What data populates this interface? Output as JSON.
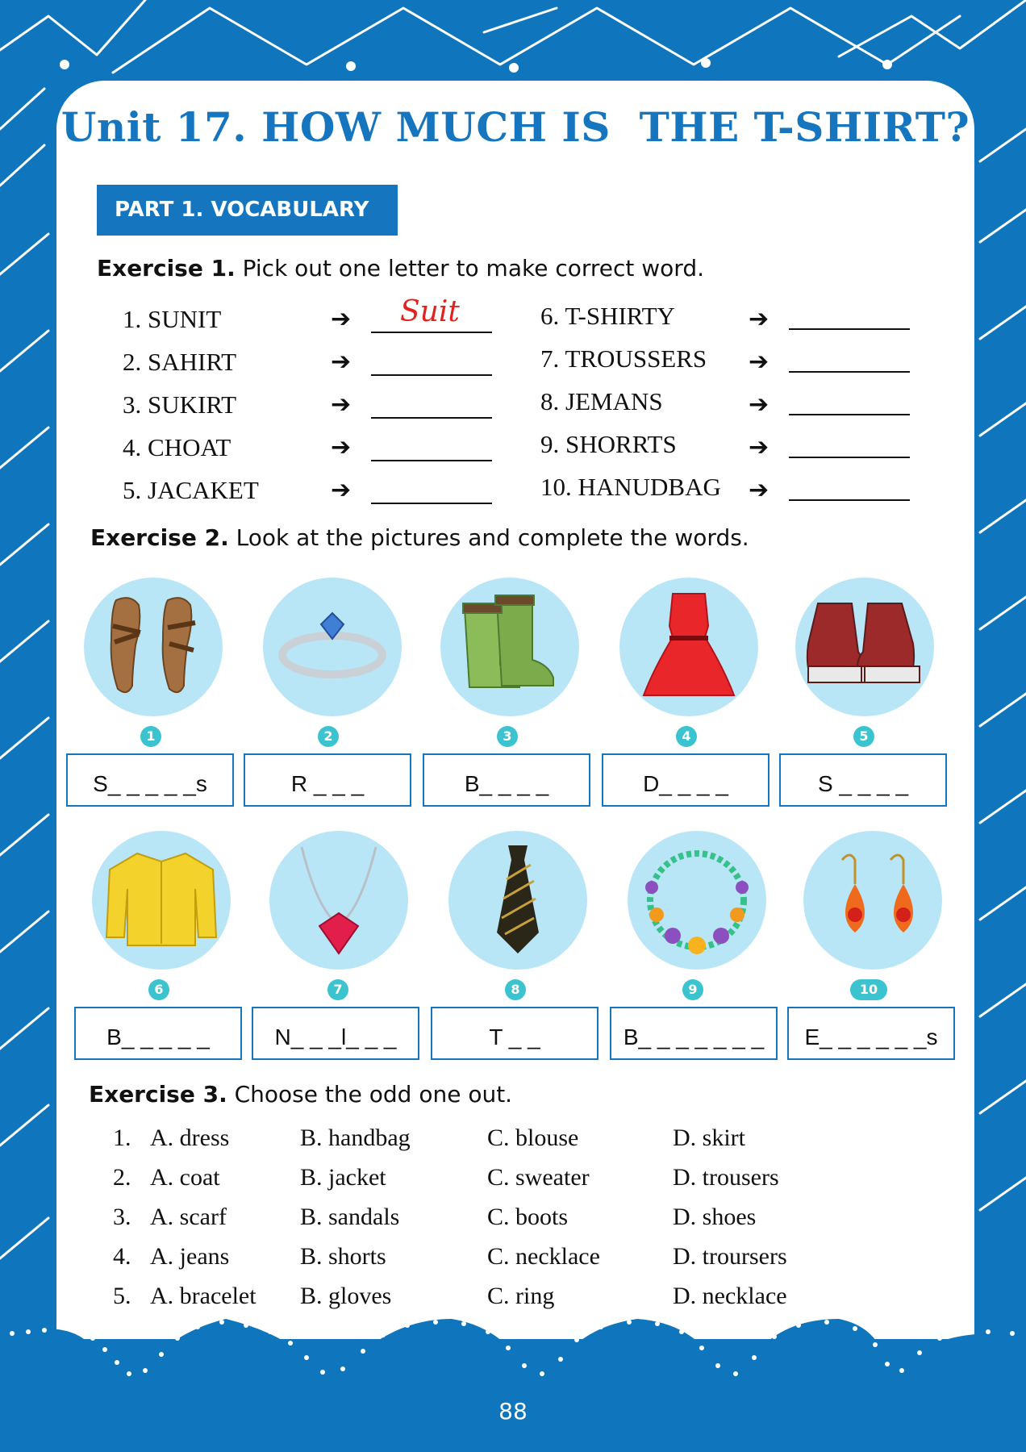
{
  "title": "Unit 17. HOW MUCH IS  THE T-SHIRT?",
  "part": "PART 1. VOCABULARY",
  "exercise1": {
    "label": "Exercise 1.",
    "instruction": " Pick out one letter to make correct word.",
    "arrow": "➔",
    "left": [
      "1. SUNIT",
      "2. SAHIRT",
      "3. SUKIRT",
      "4. CHOAT",
      "5. JACAKET"
    ],
    "right": [
      "6. T-SHIRTY",
      "7. TROUSSERS",
      "8. JEMANS",
      "9. SHORRTS",
      "10. HANUDBAG"
    ],
    "answer1": "Suit"
  },
  "exercise2": {
    "label": "Exercise 2.",
    "instruction": " Look at the pictures and complete the words.",
    "items": [
      {
        "num": "1",
        "icon": "sandals-icon",
        "hint": "S_ _ _ _ _s"
      },
      {
        "num": "2",
        "icon": "ring-icon",
        "hint": "R _ _ _"
      },
      {
        "num": "3",
        "icon": "boots-icon",
        "hint": "B_ _ _ _"
      },
      {
        "num": "4",
        "icon": "dress-icon",
        "hint": "D_ _ _ _"
      },
      {
        "num": "5",
        "icon": "shoes-icon",
        "hint": "S _ _ _ _"
      },
      {
        "num": "6",
        "icon": "blouse-icon",
        "hint": "B_ _ _ _ _"
      },
      {
        "num": "7",
        "icon": "necklace-icon",
        "hint": "N_ _ _l_ _ _"
      },
      {
        "num": "8",
        "icon": "tie-icon",
        "hint": "T _ _"
      },
      {
        "num": "9",
        "icon": "bracelet-icon",
        "hint": "B_ _ _ _ _ _ _"
      },
      {
        "num": "10",
        "icon": "earrings-icon",
        "hint": "E_ _ _ _ _ _s"
      }
    ]
  },
  "exercise3": {
    "label": "Exercise 3.",
    "instruction": " Choose the odd one out.",
    "rows": [
      {
        "n": "1.",
        "a": "A. dress",
        "b": "B. handbag",
        "c": "C. blouse",
        "d": "D. skirt"
      },
      {
        "n": "2.",
        "a": "A. coat",
        "b": "B. jacket",
        "c": "C. sweater",
        "d": "D. trousers"
      },
      {
        "n": "3.",
        "a": "A. scarf",
        "b": "B. sandals",
        "c": "C. boots",
        "d": "D. shoes"
      },
      {
        "n": "4.",
        "a": "A. jeans",
        "b": "B. shorts",
        "c": "C. necklace",
        "d": "D. troursers"
      },
      {
        "n": "5.",
        "a": "A. bracelet",
        "b": "B. gloves",
        "c": "C. ring",
        "d": "D. necklace"
      }
    ]
  },
  "page_number": "88",
  "colors": {
    "brand": "#1576bf",
    "background": "#0f75bc",
    "answer": "#e3221e",
    "circle": "#b9e6f7",
    "badge": "#3bc3cf"
  }
}
